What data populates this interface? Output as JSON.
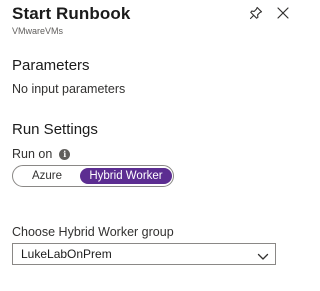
{
  "panel": {
    "title": "Start Runbook",
    "subtitle": "VMwareVMs",
    "icons": {
      "pin": "pin-icon",
      "close": "close-icon"
    }
  },
  "parameters": {
    "heading": "Parameters",
    "message": "No input parameters"
  },
  "run_settings": {
    "heading": "Run Settings",
    "run_on_label": "Run on",
    "info_icon": "info-icon",
    "options": [
      {
        "label": "Azure",
        "selected": false
      },
      {
        "label": "Hybrid Worker",
        "selected": true
      }
    ],
    "hybrid_group": {
      "label": "Choose Hybrid Worker group",
      "value": "LukeLabOnPrem",
      "chevron_icon": "chevron-down-icon"
    }
  },
  "colors": {
    "accent": "#5c2d91",
    "text": "#323130",
    "border": "#8a8886"
  }
}
